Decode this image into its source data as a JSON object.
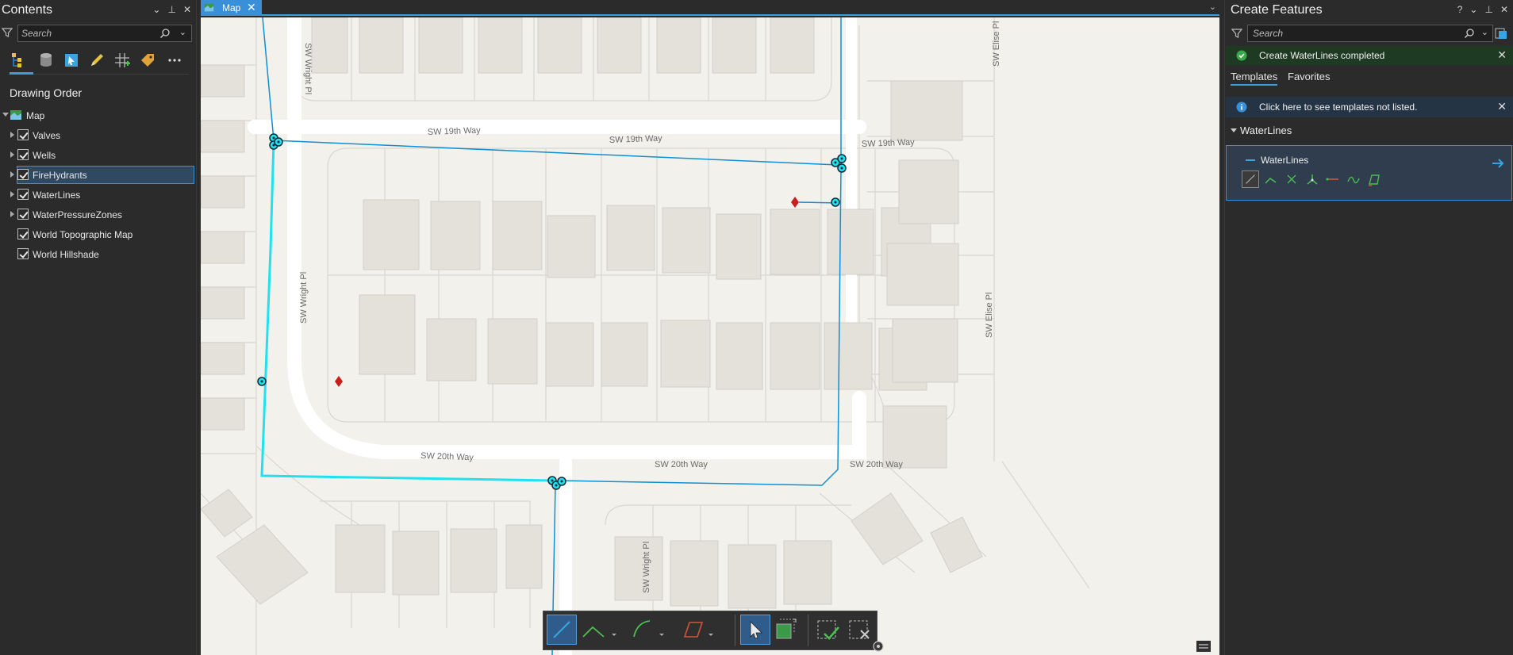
{
  "contents_pane": {
    "title": "Contents",
    "search_placeholder": "Search",
    "section_title": "Drawing Order",
    "map_label": "Map",
    "layers": [
      {
        "label": "Valves",
        "checked": true,
        "selected": false
      },
      {
        "label": "Wells",
        "checked": true,
        "selected": false
      },
      {
        "label": "FireHydrants",
        "checked": true,
        "selected": true
      },
      {
        "label": "WaterLines",
        "checked": true,
        "selected": false
      },
      {
        "label": "WaterPressureZones",
        "checked": true,
        "selected": false
      },
      {
        "label": "World Topographic Map",
        "checked": true,
        "selected": false
      },
      {
        "label": "World Hillshade",
        "checked": true,
        "selected": false
      }
    ],
    "toolbar_icons": [
      "list-by-drawing-order-icon",
      "list-by-data-source-icon",
      "list-by-selection-icon",
      "list-by-editing-icon",
      "list-by-snapping-icon",
      "list-by-labeling-icon",
      "more-icon"
    ]
  },
  "map_view": {
    "tab_label": "Map",
    "streets": {
      "sw_19th_way": "SW 19th Way",
      "sw_20th_way": "SW 20th Way",
      "sw_wright_pl": "SW Wright Pl",
      "sw_elise_pl": "SW Elise Pl"
    },
    "colors": {
      "waterline": "#0f8fd6",
      "selected_waterline": "#22e1ef",
      "hydrant": "#c81e1e",
      "background": "#f2f1ec",
      "road": "#ffffff",
      "building": "#e3e1da"
    }
  },
  "edit_toolbar": {
    "tools": [
      "line-icon",
      "polyline-icon",
      "arc-icon",
      "polygon-trace-icon",
      "select-icon",
      "select-extent-icon",
      "finish-icon",
      "cancel-icon"
    ]
  },
  "create_features": {
    "title": "Create Features",
    "search_placeholder": "Search",
    "success_message": "Create WaterLines completed",
    "tabs": [
      "Templates",
      "Favorites"
    ],
    "info_message": "Click here to see templates not listed.",
    "group_label": "WaterLines",
    "template_name": "WaterLines",
    "template_tools": [
      "line-tool-icon",
      "right-angle-line-icon",
      "midpoint-icon",
      "direction-distance-icon",
      "trace-icon",
      "streaming-icon",
      "freehand-icon"
    ]
  }
}
